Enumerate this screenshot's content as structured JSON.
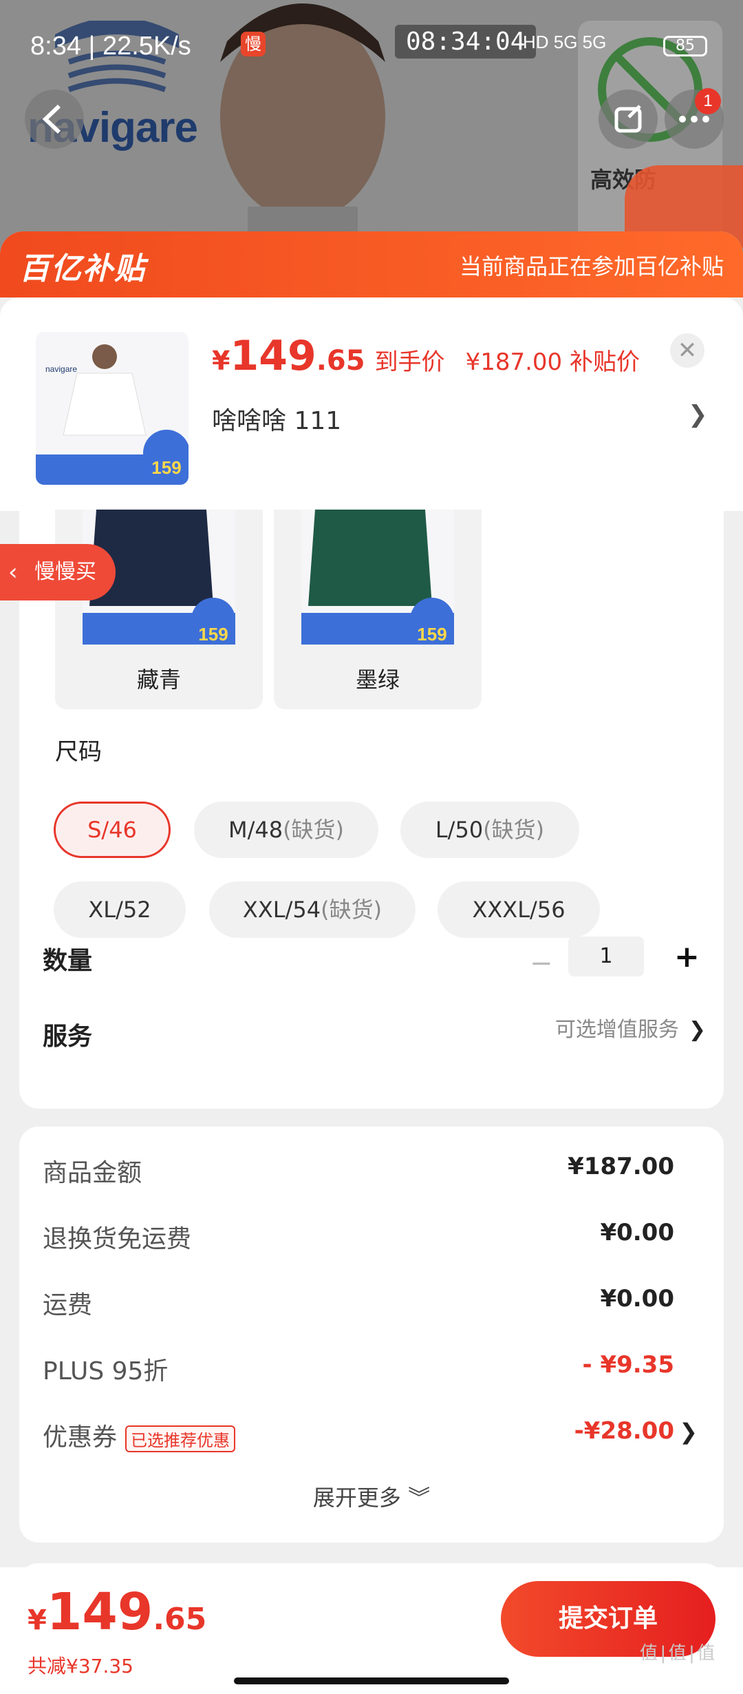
{
  "status_bar": {
    "left_text": "8:34 | 22.5K/s",
    "slow_badge": "慢",
    "clock": "08:34:04",
    "network": "HD 5G 5G",
    "battery": "85"
  },
  "background": {
    "brand": "navigare",
    "side_text": "高效防"
  },
  "nav": {
    "badge_count": "1"
  },
  "banner": {
    "logo": "百亿补贴",
    "message": "当前商品正在参加百亿补贴"
  },
  "product": {
    "currency": "¥",
    "price_int": "149",
    "price_dec": ".65",
    "price_label": "到手价",
    "subsidy_price": "¥187.00 补贴价",
    "spec": "啥啥啥  111"
  },
  "thumb": {
    "brand": "navigare",
    "badge": "159"
  },
  "colors": [
    {
      "name": "藏青",
      "color": "#1e2a44",
      "badge": "159"
    },
    {
      "name": "墨绿",
      "color": "#1f5a46",
      "badge": "159"
    }
  ],
  "slow_buy": {
    "label": "慢慢买"
  },
  "size": {
    "title": "尺码",
    "options": [
      {
        "label": "S/46",
        "oos": "",
        "selected": true
      },
      {
        "label": "M/48",
        "oos": "(缺货)"
      },
      {
        "label": "L/50",
        "oos": "(缺货)"
      },
      {
        "label": "XL/52",
        "oos": ""
      },
      {
        "label": "XXL/54",
        "oos": "(缺货)"
      },
      {
        "label": "XXXL/56",
        "oos": ""
      }
    ]
  },
  "quantity": {
    "title": "数量",
    "minus": "−",
    "value": "1",
    "plus": "+"
  },
  "service": {
    "title": "服务",
    "hint": "可选增值服务",
    "arrow": "❯"
  },
  "summary": {
    "rows": [
      {
        "label": "商品金额",
        "value": "¥187.00"
      },
      {
        "label": "退换货免运费",
        "value": "¥0.00"
      },
      {
        "label": "运费",
        "value": "¥0.00"
      },
      {
        "label": "PLUS 95折",
        "value": "- ¥9.35"
      },
      {
        "label": "优惠券",
        "tag": "已选推荐优惠",
        "value": "-¥28.00"
      }
    ],
    "expand": "展开更多 ︾"
  },
  "bottom": {
    "currency": "¥",
    "price_int": "149",
    "price_dec": ".65",
    "saving": "共减¥37.35",
    "submit": "提交订单"
  },
  "watermark": "值|值|值"
}
